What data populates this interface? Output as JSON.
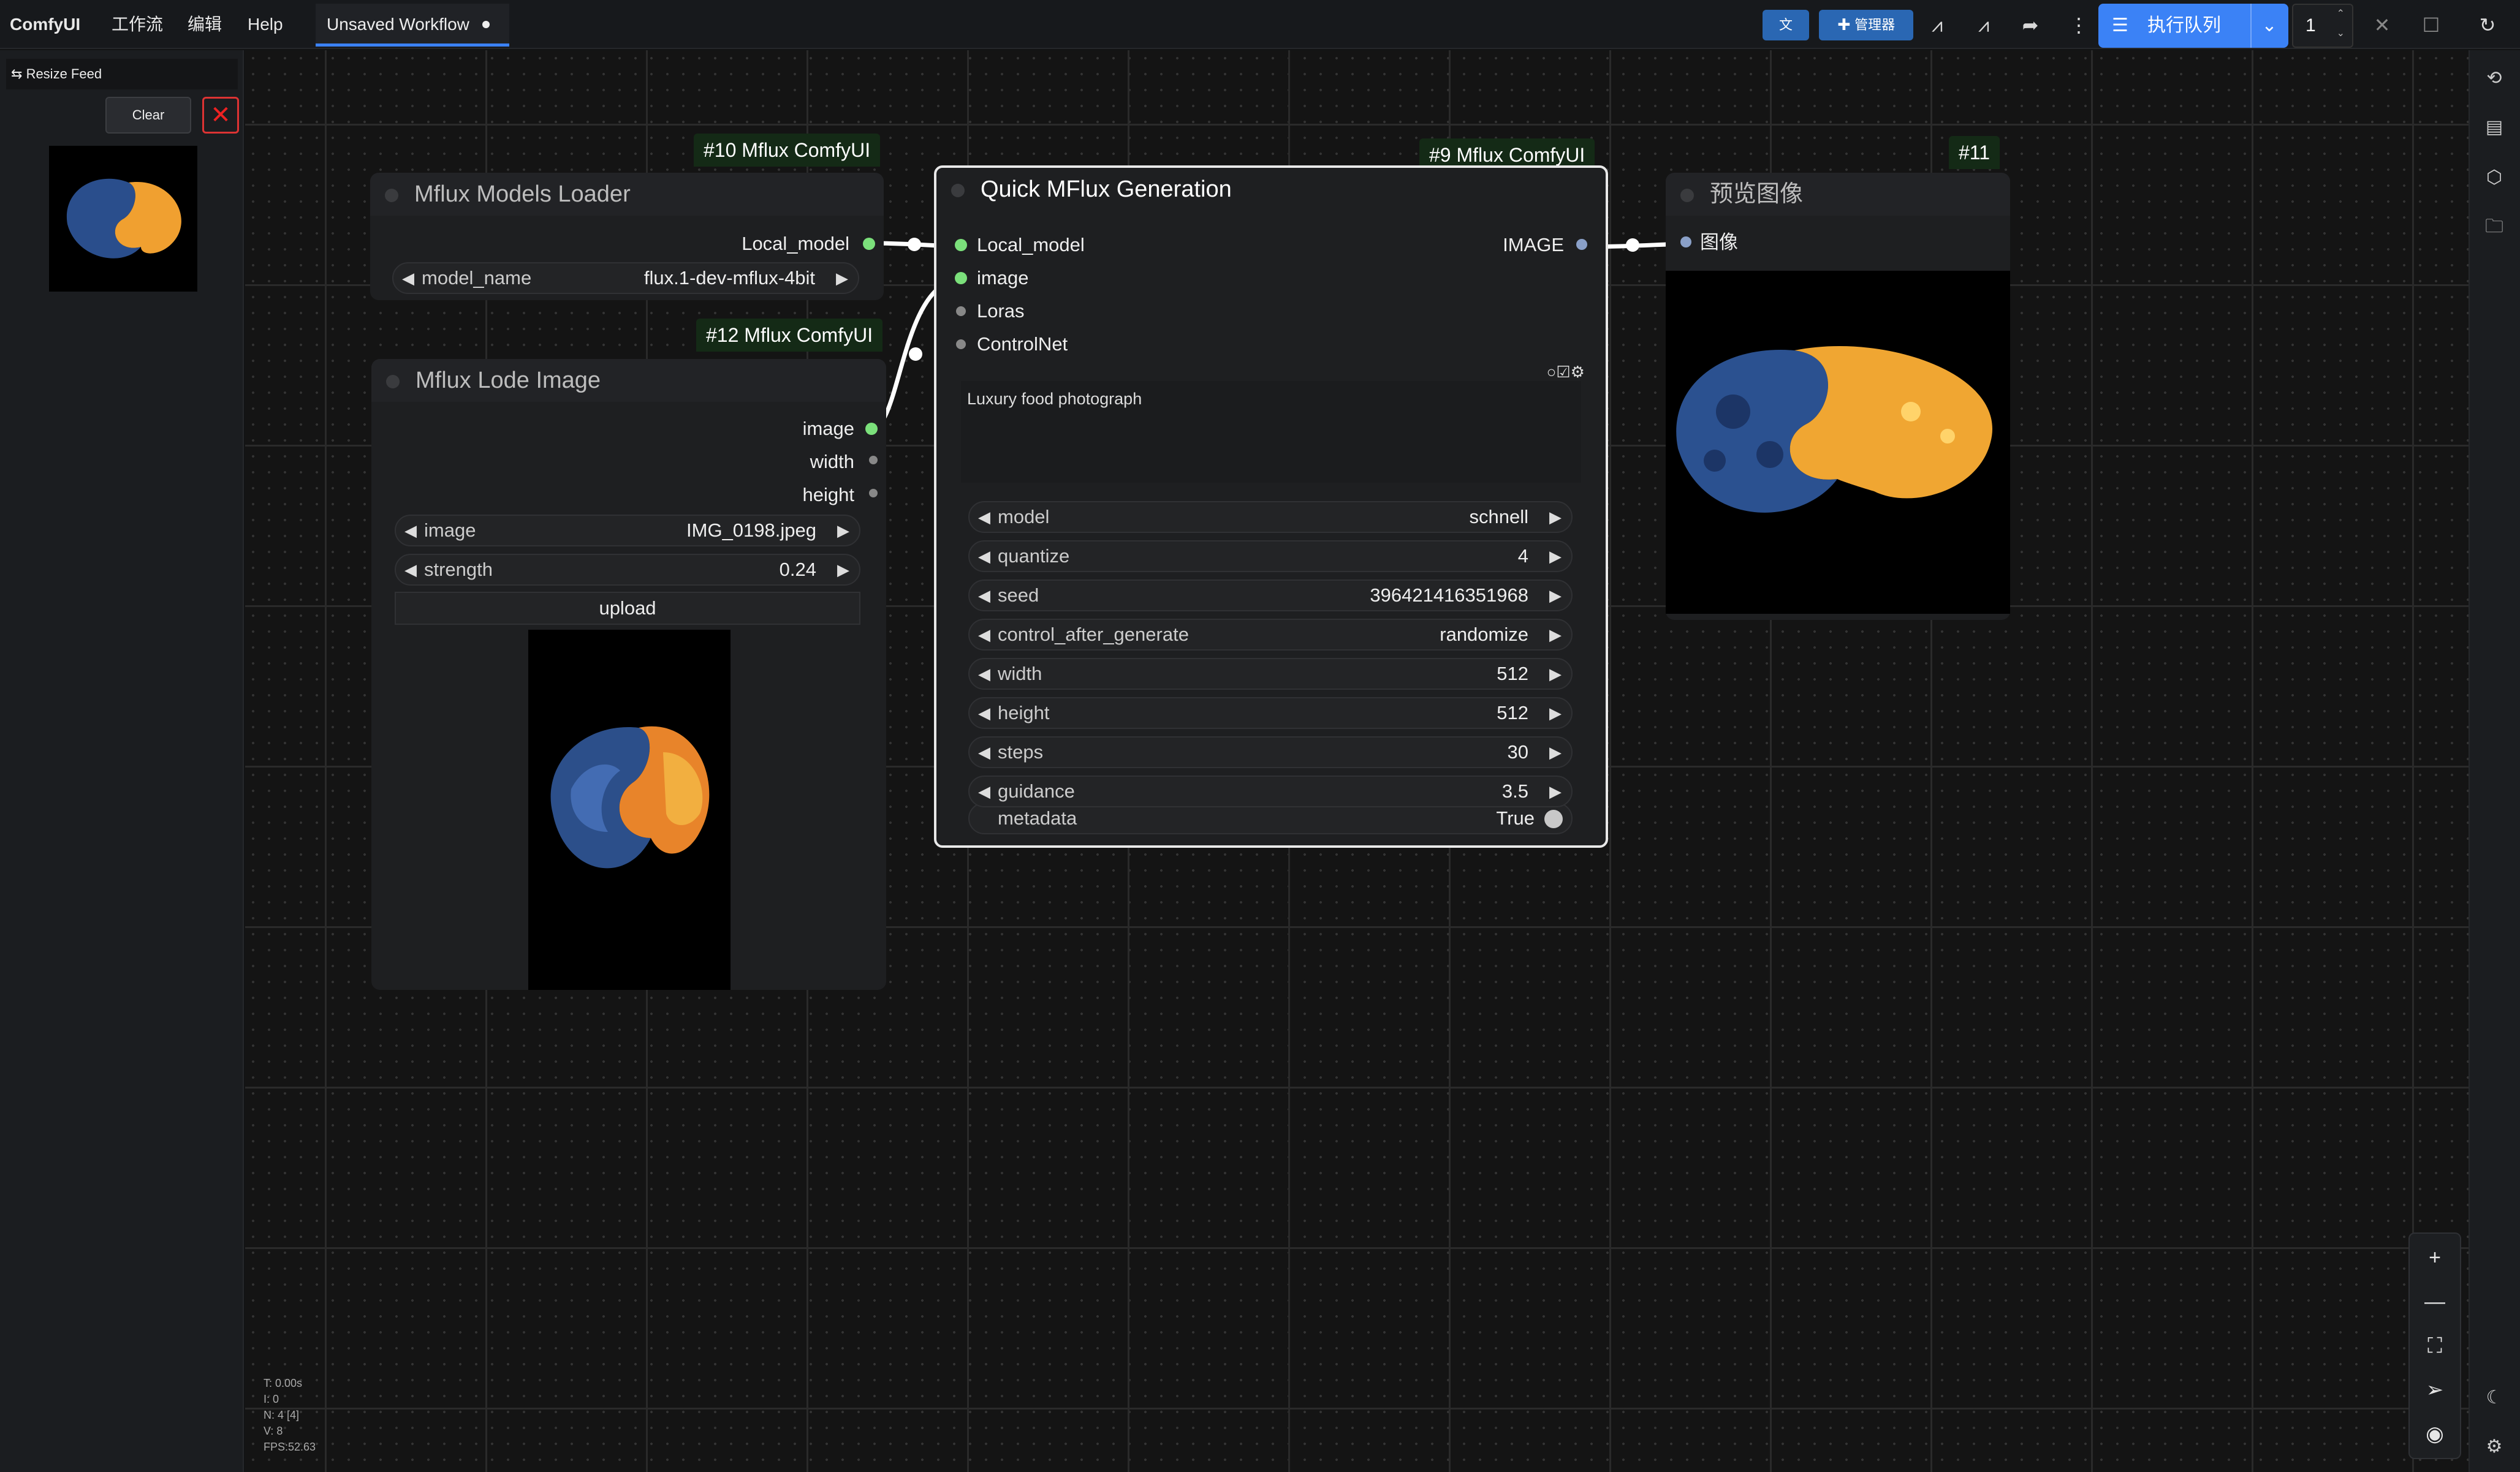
{
  "topbar": {
    "brand": "ComfyUI",
    "menu": [
      "工作流",
      "编辑",
      "Help"
    ],
    "tab_label": "Unsaved Workflow",
    "manager_label": "管理器",
    "translate_icon": "文",
    "queue_label": "执行队列",
    "queue_count": "1"
  },
  "feed": {
    "title": "Resize Feed",
    "clear_label": "Clear"
  },
  "stats": {
    "lines": [
      "T: 0.00s",
      "I: 0",
      "N: 4 [4]",
      "V: 8",
      "FPS:52.63"
    ]
  },
  "nodes": {
    "loader": {
      "badge": "#10 Mflux ComfyUI",
      "title": "Mflux Models Loader",
      "output": "Local_model",
      "widget_name": "model_name",
      "widget_value": "flux.1-dev-mflux-4bit"
    },
    "lode": {
      "badge": "#12 Mflux ComfyUI",
      "title": "Mflux Lode Image",
      "outputs": [
        "image",
        "width",
        "height"
      ],
      "widgets": [
        {
          "name": "image",
          "value": "IMG_0198.jpeg"
        },
        {
          "name": "strength",
          "value": "0.24"
        }
      ],
      "upload_label": "upload"
    },
    "quick": {
      "badge": "#9 Mflux ComfyUI",
      "title": "Quick MFlux Generation",
      "inputs": [
        "Local_model",
        "image",
        "Loras",
        "ControlNet"
      ],
      "output": "IMAGE",
      "prompt": "Luxury food photograph",
      "widgets": [
        {
          "name": "model",
          "value": "schnell"
        },
        {
          "name": "quantize",
          "value": "4"
        },
        {
          "name": "seed",
          "value": "396421416351968"
        },
        {
          "name": "control_after_generate",
          "value": "randomize"
        },
        {
          "name": "width",
          "value": "512"
        },
        {
          "name": "height",
          "value": "512"
        },
        {
          "name": "steps",
          "value": "30"
        },
        {
          "name": "guidance",
          "value": "3.5"
        }
      ],
      "toggle_name": "metadata",
      "toggle_value": "True"
    },
    "preview": {
      "badge": "#11",
      "title": "预览图像",
      "input": "图像"
    }
  },
  "colors": {
    "accent": "#3b82f6",
    "badge_bg": "#142a16",
    "port_green": "#7be07b",
    "link": "#ffffff",
    "close_red": "#dd3333"
  }
}
